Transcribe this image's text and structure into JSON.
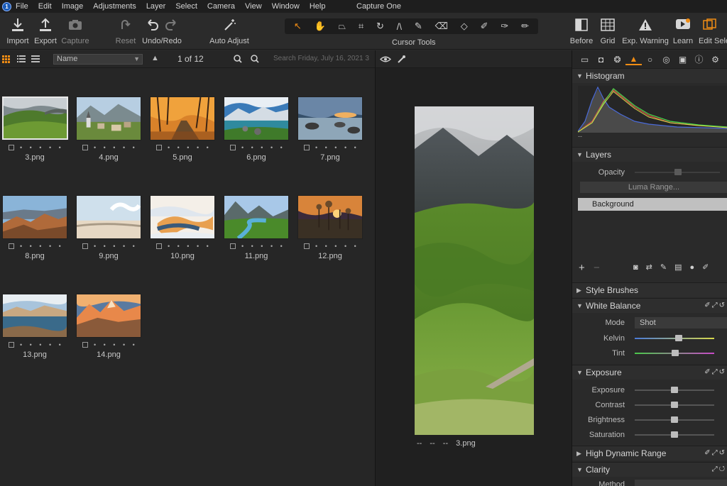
{
  "app": {
    "title": "Capture One",
    "logo": "1"
  },
  "menu": [
    "File",
    "Edit",
    "Image",
    "Adjustments",
    "Layer",
    "Select",
    "Camera",
    "View",
    "Window",
    "Help"
  ],
  "toolbar": {
    "import": "Import",
    "export": "Export",
    "capture": "Capture",
    "reset": "Reset",
    "undo_redo": "Undo/Redo",
    "auto_adjust": "Auto Adjust",
    "cursor_tools": "Cursor Tools",
    "before": "Before",
    "grid": "Grid",
    "exp_warning": "Exp. Warning",
    "learn": "Learn",
    "edit_selected": "Edit Selec"
  },
  "browser": {
    "sort": "Name",
    "counter": "1 of 12",
    "search_placeholder": "Search Friday, July 16, 2021 3",
    "items": [
      {
        "name": "3.png",
        "selected": true
      },
      {
        "name": "4.png"
      },
      {
        "name": "5.png"
      },
      {
        "name": "6.png"
      },
      {
        "name": "7.png"
      },
      {
        "name": "8.png"
      },
      {
        "name": "9.png"
      },
      {
        "name": "10.png"
      },
      {
        "name": "11.png"
      },
      {
        "name": "12.png"
      },
      {
        "name": "13.png"
      },
      {
        "name": "14.png"
      }
    ],
    "rating_dots": "• • • • •"
  },
  "viewer": {
    "caption_a": "--",
    "caption_b": "--",
    "caption_c": "--",
    "filename": "3.png"
  },
  "panel": {
    "histogram": "Histogram",
    "hist_label": "--",
    "layers": "Layers",
    "opacity": "Opacity",
    "luma_range": "Luma Range...",
    "background": "Background",
    "style_brushes": "Style Brushes",
    "white_balance": "White Balance",
    "mode_label": "Mode",
    "mode_value": "Shot",
    "kelvin": "Kelvin",
    "tint": "Tint",
    "exposure_title": "Exposure",
    "exposure": "Exposure",
    "contrast": "Contrast",
    "brightness": "Brightness",
    "saturation": "Saturation",
    "hdr": "High Dynamic Range",
    "clarity": "Clarity",
    "method": "Method"
  },
  "colors": {
    "accent": "#f08c14",
    "bg": "#2a2a2a"
  }
}
